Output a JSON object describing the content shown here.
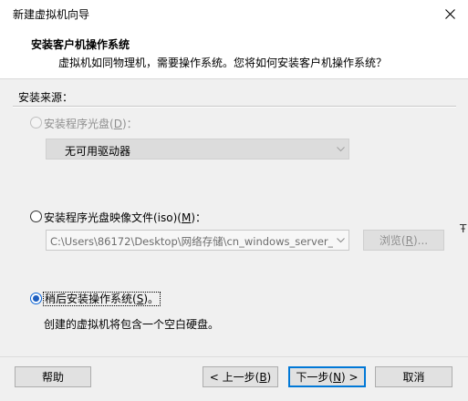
{
  "window": {
    "title": "新建虚拟机向导",
    "close_icon": "close-icon"
  },
  "header": {
    "title": "安装客户机操作系统",
    "subtitle": "虚拟机如同物理机，需要操作系统。您将如何安装客户机操作系统？"
  },
  "source": {
    "group_label": "安装来源："
  },
  "options": {
    "disc": {
      "label_pre": "安装程序光盘(",
      "label_key": "D",
      "label_post": ")：",
      "checked": false,
      "enabled": false,
      "drive_value": "无可用驱动器"
    },
    "iso": {
      "label_pre": "安装程序光盘映像文件(iso)(",
      "label_key": "M",
      "label_post": ")：",
      "checked": false,
      "enabled": true,
      "path_value": "C:\\Users\\86172\\Desktop\\网络存储\\cn_windows_server_",
      "browse_pre": "浏览(",
      "browse_key": "R",
      "browse_post": ")..."
    },
    "later": {
      "label_pre": "稍后安装操作系统(",
      "label_key": "S",
      "label_post": ")。",
      "checked": true,
      "enabled": true,
      "description": "创建的虚拟机将包含一个空白硬盘。"
    }
  },
  "side_glyph": "Ŧ",
  "footer": {
    "help": "帮助",
    "back_pre": "< 上一步(",
    "back_key": "B",
    "back_post": ")",
    "next_pre": "下一步(",
    "next_key": "N",
    "next_post": ") >",
    "cancel": "取消"
  },
  "colors": {
    "accent": "#0078d7",
    "radio_dot": "#1e5fbf"
  }
}
